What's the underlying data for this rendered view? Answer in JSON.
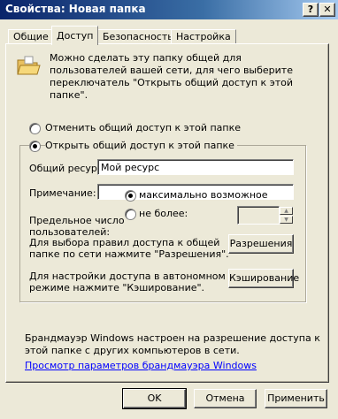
{
  "window": {
    "title": "Свойства: Новая папка",
    "help_button": "?",
    "close_button": "✕"
  },
  "tabs": [
    {
      "label": "Общие"
    },
    {
      "label": "Доступ"
    },
    {
      "label": "Безопасность"
    },
    {
      "label": "Настройка"
    }
  ],
  "sharing": {
    "intro": "Можно сделать эту папку общей для пользователей вашей сети, для чего выберите переключатель \"Открыть общий доступ к этой папке\".",
    "option_unshare": "Отменить общий доступ к этой папке",
    "option_share": "Открыть общий доступ к этой папке",
    "share_name_label": "Общий ресурс:",
    "share_name_value": "Мой ресурс",
    "comment_label": "Примечание:",
    "comment_value": "",
    "user_limit_label_1": "Предельное число",
    "user_limit_label_2": "пользователей:",
    "limit_max": "максимально возможное",
    "limit_no_more": "не более:",
    "limit_count": "",
    "permissions_text_1": "Для выбора правил доступа к общей",
    "permissions_text_2": "папке по сети нажмите \"Разрешения\".",
    "permissions_button": "Разрешения",
    "caching_text_1": "Для настройки доступа в автономном",
    "caching_text_2": "режиме нажмите \"Кэширование\".",
    "caching_button": "Кэширование",
    "firewall_text_1": "Брандмауэр Windows настроен на разрешение доступа к",
    "firewall_text_2": "этой папке с других компьютеров в сети.",
    "firewall_link": "Просмотр параметров брандмауэра Windows"
  },
  "footer": {
    "ok": "OK",
    "cancel": "Отмена",
    "apply": "Применить"
  }
}
